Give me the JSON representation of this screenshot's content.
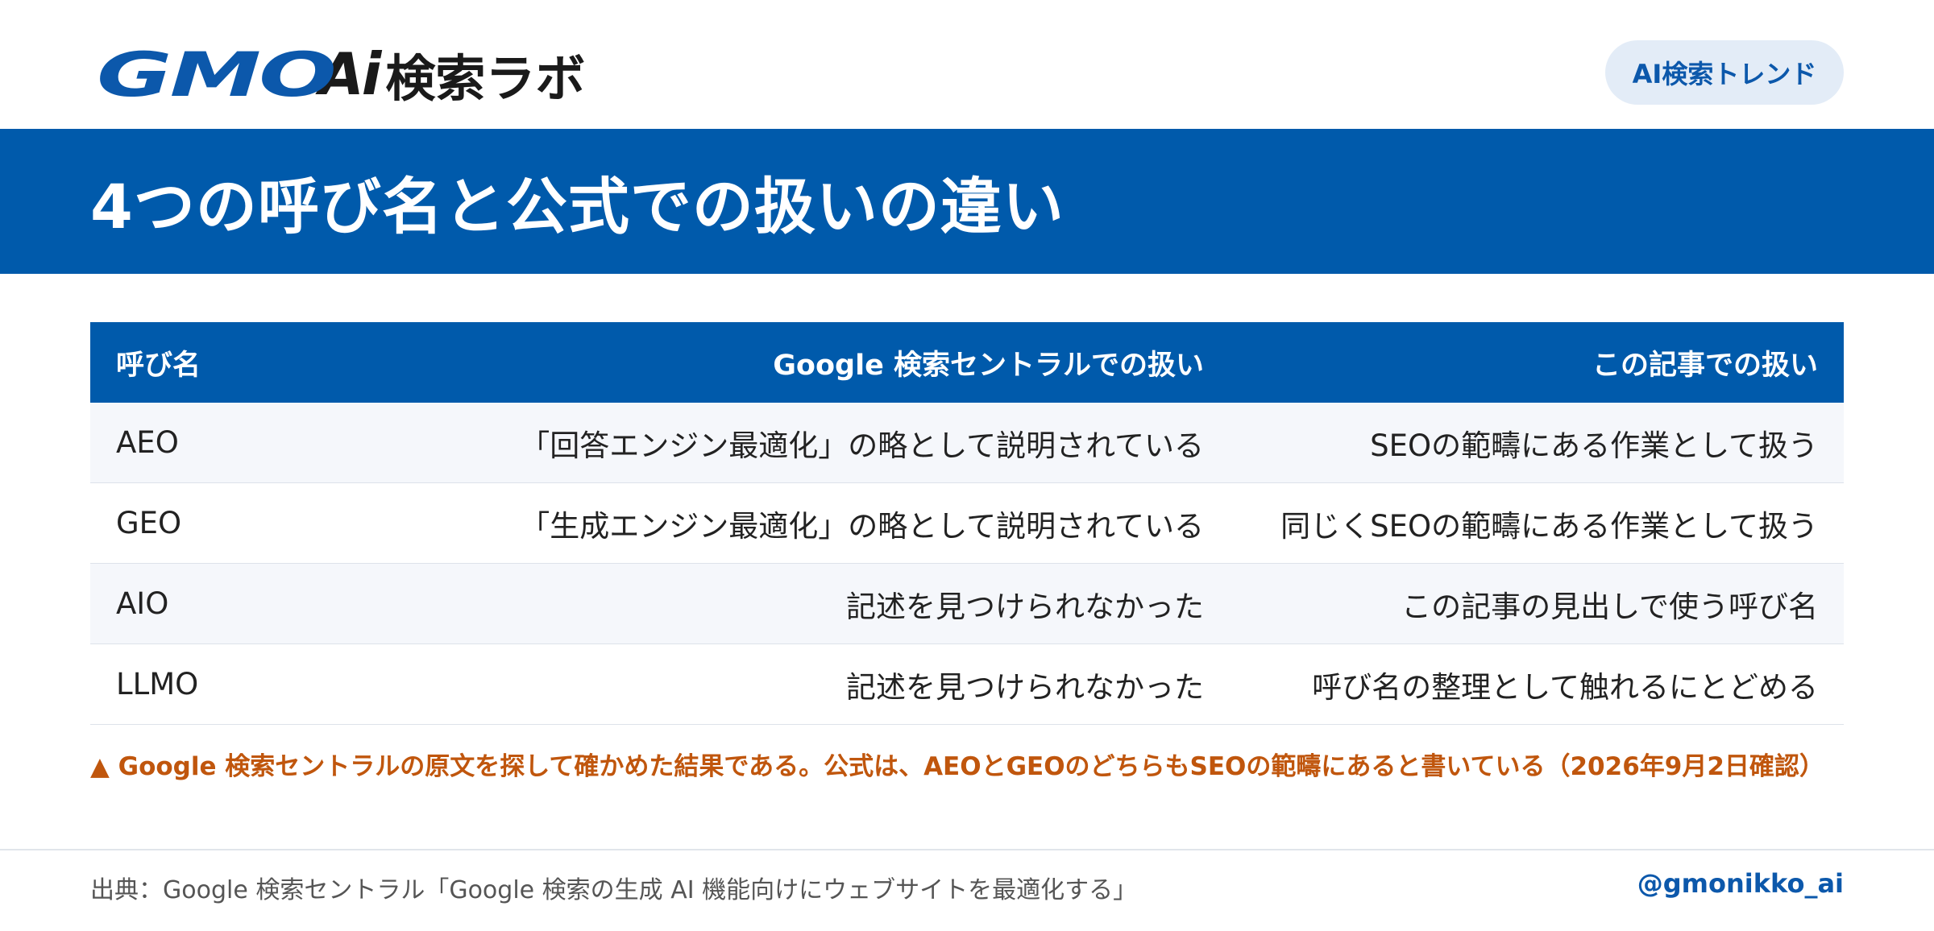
{
  "header": {
    "logo_brand": "GMO",
    "logo_ai": "Ai",
    "logo_rest": "検索ラボ",
    "badge": "AI検索トレンド"
  },
  "title": "4つの呼び名と公式での扱いの違い",
  "table": {
    "headers": [
      "呼び名",
      "Google 検索セントラルでの扱い",
      "この記事での扱い"
    ],
    "rows": [
      [
        "AEO",
        "「回答エンジン最適化」の略として説明されている",
        "SEOの範疇にある作業として扱う"
      ],
      [
        "GEO",
        "「生成エンジン最適化」の略として説明されている",
        "同じくSEOの範疇にある作業として扱う"
      ],
      [
        "AIO",
        "記述を見つけられなかった",
        "この記事の見出しで使う呼び名"
      ],
      [
        "LLMO",
        "記述を見つけられなかった",
        "呼び名の整理として触れるにとどめる"
      ]
    ]
  },
  "note": "▲ Google 検索セントラルの原文を探して確かめた結果である。公式は、AEOとGEOのどちらもSEOの範疇にあると書いている（2026年9月2日確認）",
  "footer": {
    "source": "出典：Google 検索セントラル「Google 検索の生成 AI 機能向けにウェブサイトを最適化する」",
    "handle": "@gmonikko_ai"
  },
  "colors": {
    "brand_blue": "#005aab",
    "note_orange": "#c0560d",
    "badge_bg": "#e3ecf7",
    "row_alt": "#f5f7fb"
  }
}
